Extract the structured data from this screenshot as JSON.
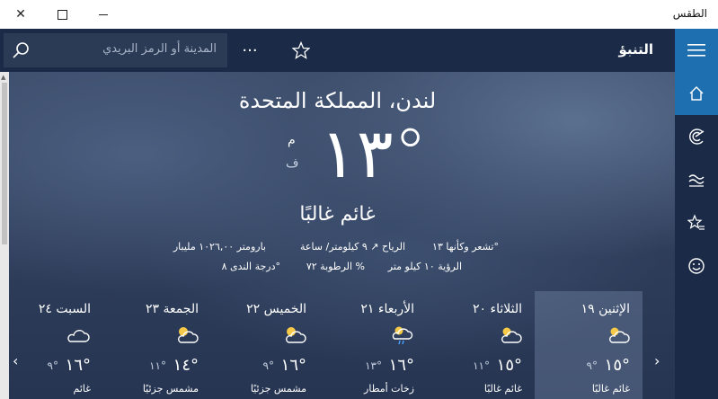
{
  "window": {
    "title": "الطقس"
  },
  "topbar": {
    "app_title": "التنبؤ",
    "search_placeholder": "المدينة أو الرمز البريدي"
  },
  "current": {
    "city": "لندن، المملكة المتحدة",
    "temp": "١٣°",
    "unit_c": "م",
    "unit_f": "ف",
    "condition": "غائم غالبًا",
    "feels_like": "تشعر وكأنها  ١٣°",
    "wind": "الرياح  ↗ ٩ كيلومتر/ ساعة",
    "barometer": "بارومتر  ١٠٢٦,٠٠ مليبار",
    "visibility": "الرؤية  ١٠ كيلو متر",
    "humidity": "الرطوبة   ٧٢ %",
    "dew_point": "درجة الندى  ٨°"
  },
  "forecast": [
    {
      "day": "الإثنين ١٩",
      "hi": "١٥°",
      "lo": "٩°",
      "cond": "غائم غالبًا",
      "icon": "partly-cloudy-icon"
    },
    {
      "day": "الثلاثاء ٢٠",
      "hi": "١٥°",
      "lo": "١١°",
      "cond": "غائم غالبًا",
      "icon": "partly-cloudy-icon"
    },
    {
      "day": "الأربعاء ٢١",
      "hi": "١٦°",
      "lo": "١٣°",
      "cond": "زخات أمطار",
      "icon": "rain-showers-icon"
    },
    {
      "day": "الخميس ٢٢",
      "hi": "١٦°",
      "lo": "٩°",
      "cond": "مشمس جزئيًا",
      "icon": "partly-sunny-icon"
    },
    {
      "day": "الجمعة ٢٣",
      "hi": "١٤°",
      "lo": "١١°",
      "cond": "مشمس جزئيًا",
      "icon": "partly-sunny-icon"
    },
    {
      "day": "السبت ٢٤",
      "hi": "١٦°",
      "lo": "٩°",
      "cond": "غائم",
      "icon": "cloudy-icon"
    }
  ]
}
